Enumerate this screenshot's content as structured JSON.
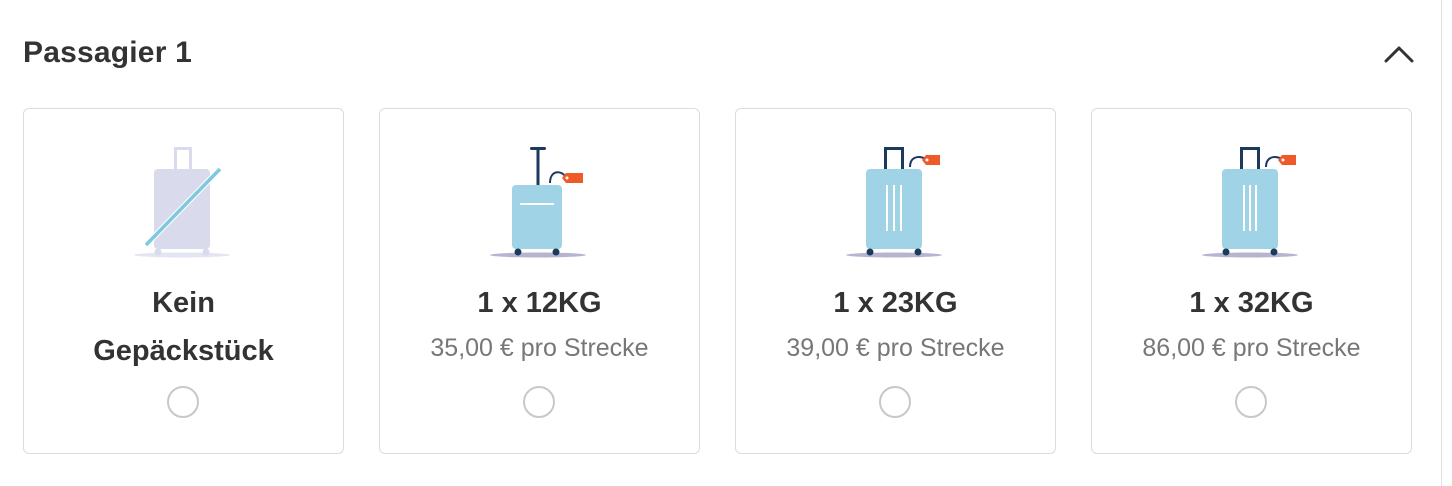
{
  "passenger": {
    "title": "Passagier 1",
    "collapse_icon": "chevron-up-icon"
  },
  "baggage_options": [
    {
      "title_line1": "Kein",
      "title_line2": "Gepäckstück",
      "icon": "no-baggage-icon",
      "selected": false
    },
    {
      "title": "1 x 12KG",
      "price": "35,00 € pro Strecke",
      "icon": "small-suitcase-icon",
      "selected": false
    },
    {
      "title": "1 x 23KG",
      "price": "39,00 € pro Strecke",
      "icon": "medium-suitcase-icon",
      "selected": false
    },
    {
      "title": "1 x 32KG",
      "price": "86,00 € pro Strecke",
      "icon": "large-suitcase-icon",
      "selected": false
    }
  ],
  "colors": {
    "suitcase_blue": "#a0d3e6",
    "suitcase_frame": "#1c3a5e",
    "luggage_tag": "#f05a28",
    "no_baggage_gray": "#d9dbec",
    "no_baggage_slash": "#7ec8e3",
    "shadow": "#b7b4cf"
  }
}
